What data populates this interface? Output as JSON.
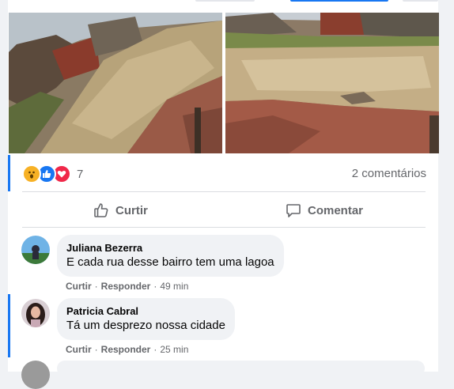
{
  "colors": {
    "accent": "#1877f2",
    "love": "#f02849",
    "wow": "#f7b125",
    "muted": "#65676b"
  },
  "reactions": {
    "icons": [
      "wow-icon",
      "like-icon",
      "love-icon"
    ],
    "count": "7",
    "comments": "2 comentários"
  },
  "actions": {
    "like_label": "Curtir",
    "comment_label": "Comentar"
  },
  "comments": [
    {
      "name": "Juliana Bezerra",
      "text": "E cada rua desse bairro tem uma lagoa",
      "like": "Curtir",
      "reply": "Responder",
      "time": "49 min"
    },
    {
      "name": "Patricia Cabral",
      "text": "Tá um desprezo nossa cidade",
      "like": "Curtir",
      "reply": "Responder",
      "time": "25 min"
    }
  ],
  "meta_separator": "·"
}
